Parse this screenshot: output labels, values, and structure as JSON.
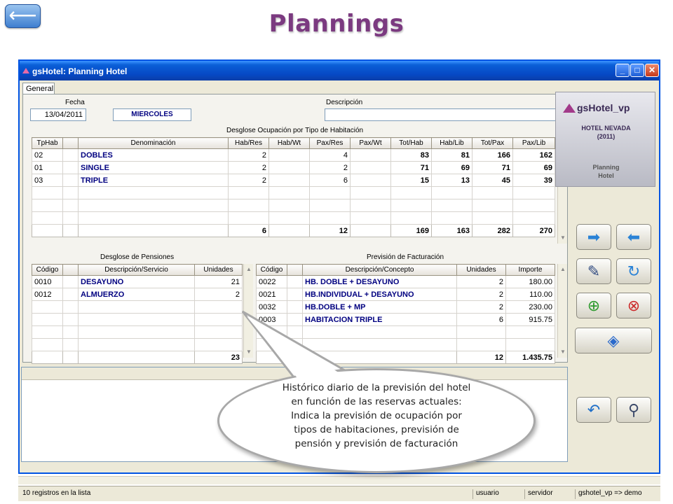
{
  "slide": {
    "title": "Plannings",
    "back_glyph": "⟵"
  },
  "window": {
    "title": "gsHotel: Planning Hotel",
    "min": "_",
    "max": "□",
    "close": "✕"
  },
  "tabs": [
    {
      "label": "General"
    }
  ],
  "form": {
    "fecha_label": "Fecha",
    "fecha_value": "13/04/2011",
    "weekday": "MIERCOLES",
    "descripcion_label": "Descripción",
    "descripcion_value": ""
  },
  "occupancy": {
    "title": "Desglose Ocupación por Tipo de Habitación",
    "columns": [
      "TpHab",
      "",
      "Denominación",
      "Hab/Res",
      "Hab/Wt",
      "Pax/Res",
      "Pax/Wt",
      "Tot/Hab",
      "Hab/Lib",
      "Tot/Pax",
      "Pax/Lib"
    ],
    "rows": [
      {
        "tp": "02",
        "den": "DOBLES",
        "hab_res": "2",
        "hab_wt": "",
        "pax_res": "4",
        "pax_wt": "",
        "tot_hab": "83",
        "hab_lib": "81",
        "tot_pax": "166",
        "pax_lib": "162"
      },
      {
        "tp": "01",
        "den": "SINGLE",
        "hab_res": "2",
        "hab_wt": "",
        "pax_res": "2",
        "pax_wt": "",
        "tot_hab": "71",
        "hab_lib": "69",
        "tot_pax": "71",
        "pax_lib": "69"
      },
      {
        "tp": "03",
        "den": "TRIPLE",
        "hab_res": "2",
        "hab_wt": "",
        "pax_res": "6",
        "pax_wt": "",
        "tot_hab": "15",
        "hab_lib": "13",
        "tot_pax": "45",
        "pax_lib": "39"
      }
    ],
    "totals": {
      "hab_res": "6",
      "pax_res": "12",
      "tot_hab": "169",
      "hab_lib": "163",
      "tot_pax": "282",
      "pax_lib": "270"
    }
  },
  "pensions": {
    "title": "Desglose de Pensiones",
    "columns": [
      "Código",
      "",
      "Descripción/Servicio",
      "Unidades"
    ],
    "rows": [
      {
        "code": "0010",
        "desc": "DESAYUNO",
        "units": "21"
      },
      {
        "code": "0012",
        "desc": "ALMUERZO",
        "units": "2"
      }
    ],
    "total_units": "23"
  },
  "billing": {
    "title": "Previsión de Facturación",
    "columns": [
      "Código",
      "",
      "Descripción/Concepto",
      "Unidades",
      "Importe"
    ],
    "rows": [
      {
        "code": "0022",
        "desc": "HB. DOBLE + DESAYUNO",
        "units": "2",
        "amount": "180.00"
      },
      {
        "code": "0021",
        "desc": "HB.INDIVIDUAL + DESAYUNO",
        "units": "2",
        "amount": "110.00"
      },
      {
        "code": "0032",
        "desc": "HB.DOBLE + MP",
        "units": "2",
        "amount": "230.00"
      },
      {
        "code": "0003",
        "desc": "HABITACION TRIPLE",
        "units": "6",
        "amount": "915.75"
      }
    ],
    "total_units": "12",
    "total_amount": "1.435.75"
  },
  "logo_card": {
    "brand": "gsHotel_vp",
    "hotel": "HOTEL NEVADA",
    "year": "(2011)",
    "module_1": "Planning",
    "module_2": "Hotel"
  },
  "toolbar": {
    "next_icon": "➡",
    "prev_icon": "⬅",
    "edit_icon": "✎",
    "refresh_icon": "↻",
    "add_icon": "⊕",
    "delete_icon": "⊗",
    "view_icon": "◈",
    "undo_icon": "↶",
    "search_icon": "⚲"
  },
  "status": {
    "count": "10 registros en la lista",
    "user": "usuario",
    "server": "servidor",
    "session": "gshotel_vp => demo"
  },
  "callout": {
    "line1": "Histórico diario de la previsión del hotel",
    "line2": "en función de las reservas actuales:",
    "line3": "Indica la previsión de ocupación por",
    "line4": "tipos de habitaciones, previsión de",
    "line5": "pensión y previsión de facturación"
  }
}
